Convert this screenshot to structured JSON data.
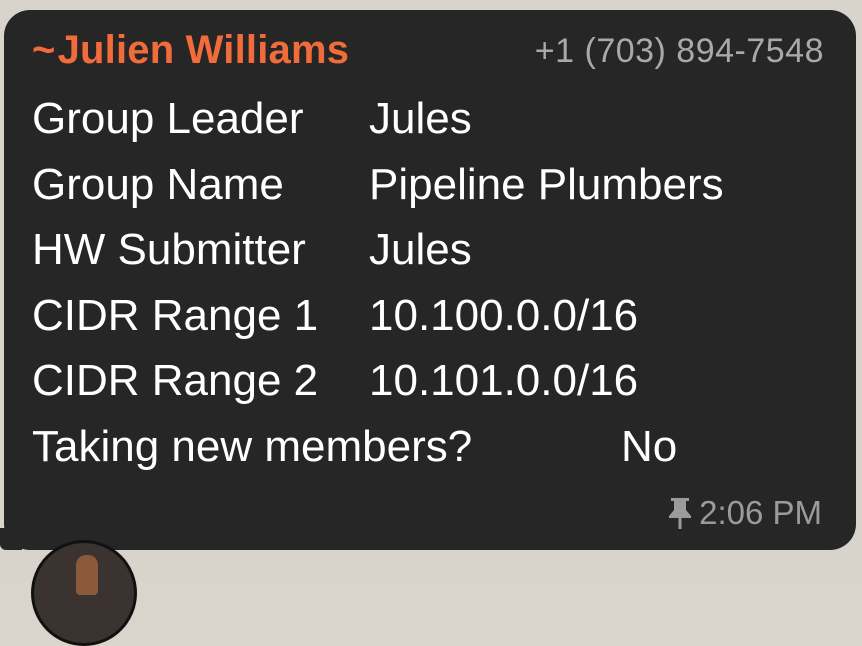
{
  "message": {
    "sender": {
      "prefix": "~",
      "name": "Julien Williams",
      "phone": "+1 (703) 894-7548",
      "name_color": "#f26b3a"
    },
    "fields": [
      {
        "label": "Group Leader",
        "value": "Jules"
      },
      {
        "label": "Group Name",
        "value": "Pipeline Plumbers"
      },
      {
        "label": "HW Submitter",
        "value": "Jules"
      },
      {
        "label": "CIDR Range 1",
        "value": "10.100.0.0/16"
      },
      {
        "label": "CIDR Range 2",
        "value": "10.101.0.0/16"
      },
      {
        "label": "Taking new members?",
        "value": "No"
      }
    ],
    "time": "2:06 PM",
    "pinned_icon": "pin-icon",
    "bubble_color": "#262626"
  },
  "avatar": {
    "icon": "avatar"
  }
}
